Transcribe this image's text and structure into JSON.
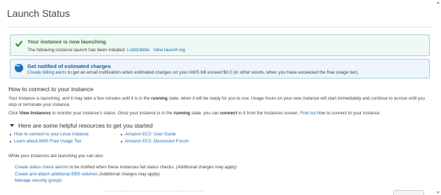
{
  "page": {
    "title": "Launch Status"
  },
  "success_alert": {
    "heading": "Your instance is now launching",
    "body_prefix": "The following instance launch has been initiated: ",
    "instance_id": "i-c8d19d9e",
    "view_log": "View launch log",
    "icon": "check-icon",
    "color": "#2b7c2b"
  },
  "info_alert": {
    "heading": "Get notified of estimated charges",
    "link": "Create billing alerts",
    "body_suffix": " to get an email notification when estimated charges on your AWS bill exceed $0.0 (in other words, when you have exceeded the free usage tier).",
    "icon": "chat-icon",
    "color": "#1f5c9c"
  },
  "connect": {
    "title": "How to connect to your instance",
    "p1_a": "Your instance is launching, and it may take a few minutes until it is in the ",
    "p1_bold": "running",
    "p1_b": " state, when it will be ready for you to use. Usage hours on your new instance will start immediately and continue to accrue until you stop or terminate your instance.",
    "p2_a": "Click ",
    "p2_bold1": "View Instances",
    "p2_b": " to monitor your instance's status. Once your instance is in the ",
    "p2_bold2": "running",
    "p2_c": " state, you can ",
    "p2_bold3": "connect",
    "p2_d": " to it from the Instances screen. ",
    "p2_link": "Find out",
    "p2_e": " how to connect to your instance."
  },
  "resources": {
    "title": "Here are some helpful resources to get you started",
    "left": [
      "How to connect to your Linux instance",
      "Learn about AWS Free Usage Tier"
    ],
    "right": [
      "Amazon EC2: User Guide",
      "Amazon EC2: Discussion Forum"
    ]
  },
  "while_launching": {
    "text": "While your instances are launching you can also",
    "action1_link": "Create status check alarms",
    "action1_text": " to be notified when these instances fail status checks. (Additional charges may apply)",
    "action2_link": "Create and attach additional EBS volumes",
    "action2_text": " (Additional charges may apply)",
    "action3_link": "Manage security groups"
  }
}
